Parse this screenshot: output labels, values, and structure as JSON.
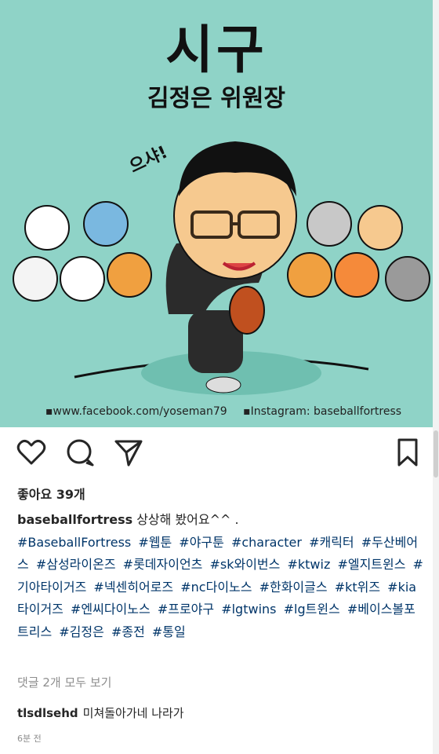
{
  "post": {
    "headline": "시구",
    "subheadline": "김정은 위원장",
    "shout": "으샤!",
    "credit_facebook": "▪www.facebook.com/yoseman79",
    "credit_instagram": "▪Instagram: baseballfortress"
  },
  "actions": {
    "like_icon": "heart-icon",
    "comment_icon": "comment-icon",
    "share_icon": "send-icon",
    "save_icon": "bookmark-icon"
  },
  "likes": "좋아요 39개",
  "caption": {
    "username": "baseballfortress",
    "text": " 상상해 봤어요^^ .",
    "hashtags": [
      "#BaseballFortress",
      "#웹툰",
      "#야구툰",
      "#character",
      "#캐릭터",
      "#두산베어스",
      "#삼성라이온즈",
      "#롯데자이언츠",
      "#sk와이번스",
      "#ktwiz",
      "#엘지트윈스",
      "#기아타이거즈",
      "#넥센히어로즈",
      "#nc다이노스",
      "#한화이글스",
      "#kt위즈",
      "#kia타이거즈",
      "#엔씨다이노스",
      "#프로야구",
      "#lgtwins",
      "#lg트윈스",
      "#베이스볼포트리스",
      "#김정은",
      "#종전",
      "#통일"
    ]
  },
  "view_comments": "댓글 2개 모두 보기",
  "comment": {
    "username": "tlsdlsehd",
    "text": "미쳐돌아가네 나라가"
  },
  "timestamp": "6분 전",
  "colors": {
    "image_bg": "#8fd3c7",
    "hashtag": "#003569",
    "muted": "#8e8e8e"
  }
}
